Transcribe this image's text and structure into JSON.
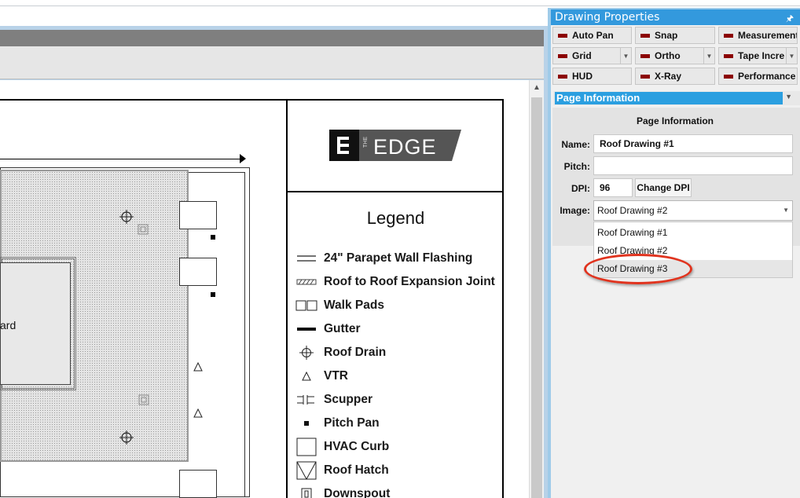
{
  "drawing": {
    "room_label_fragment": "ard",
    "logo_text": "EDGE",
    "logo_prefix": "THE",
    "legend": {
      "title": "Legend",
      "items": [
        {
          "label": "24\" Parapet Wall Flashing",
          "icon": "parapet-lines-icon"
        },
        {
          "label": "Roof to Roof Expansion Joint",
          "icon": "expansion-joint-icon"
        },
        {
          "label": "Walk Pads",
          "icon": "walk-pads-icon"
        },
        {
          "label": "Gutter",
          "icon": "gutter-icon"
        },
        {
          "label": "Roof Drain",
          "icon": "roof-drain-icon"
        },
        {
          "label": "VTR",
          "icon": "vtr-triangle-icon"
        },
        {
          "label": "Scupper",
          "icon": "scupper-icon"
        },
        {
          "label": "Pitch Pan",
          "icon": "pitch-pan-icon"
        },
        {
          "label": "HVAC Curb",
          "icon": "hvac-curb-icon"
        },
        {
          "label": "Roof Hatch",
          "icon": "roof-hatch-icon"
        },
        {
          "label": "Downspout",
          "icon": "downspout-icon"
        }
      ]
    }
  },
  "panel": {
    "title": "Drawing Properties",
    "pin_icon": "pin-icon",
    "toggles": [
      {
        "label": "Auto Pan",
        "has_dropdown": false
      },
      {
        "label": "Snap",
        "has_dropdown": false
      },
      {
        "label": "Measurement",
        "has_dropdown": false
      },
      {
        "label": "Grid",
        "has_dropdown": true
      },
      {
        "label": "Ortho",
        "has_dropdown": true
      },
      {
        "label": "Tape Incre",
        "has_dropdown": true
      },
      {
        "label": "HUD",
        "has_dropdown": false
      },
      {
        "label": "X-Ray",
        "has_dropdown": false
      },
      {
        "label": "Performance",
        "has_dropdown": false
      }
    ],
    "section_selector": "Page Information",
    "page_info": {
      "title": "Page Information",
      "name_label": "Name:",
      "name_value": "Roof Drawing #1",
      "pitch_label": "Pitch:",
      "pitch_value": "",
      "dpi_label": "DPI:",
      "dpi_value": "96",
      "change_dpi_label": "Change DPI",
      "image_label": "Image:",
      "image_selected": "Roof Drawing #2",
      "image_options": [
        "Roof Drawing #1",
        "Roof Drawing #2",
        "Roof Drawing #3"
      ],
      "hovered_option": "Roof Drawing #3"
    },
    "highlight_color": "#e0331e",
    "accent_color": "#3399dd"
  }
}
